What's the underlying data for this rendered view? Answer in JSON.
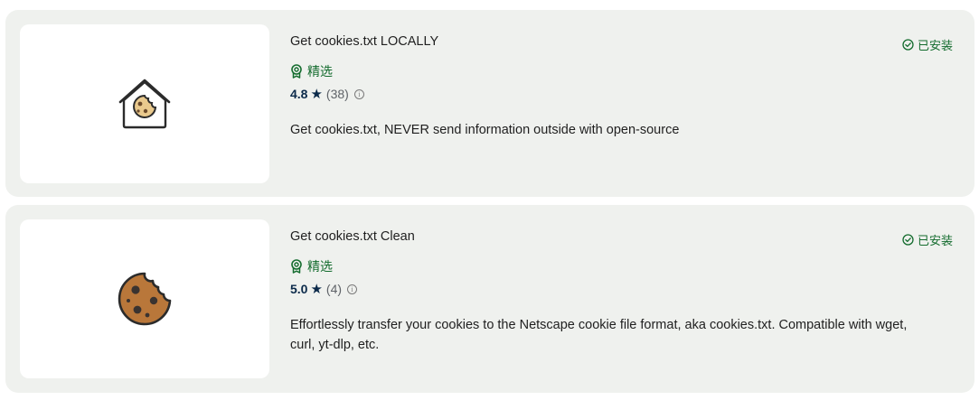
{
  "extensions": [
    {
      "title": "Get cookies.txt LOCALLY",
      "badge": "精选",
      "rating": "4.8",
      "rating_count": "(38)",
      "description": "Get cookies.txt, NEVER send information outside with open-source",
      "status": "已安装",
      "icon": "cookie-house-icon"
    },
    {
      "title": "Get cookies.txt Clean",
      "badge": "精选",
      "rating": "5.0",
      "rating_count": "(4)",
      "description": "Effortlessly transfer your cookies to the Netscape cookie file format, aka cookies.txt. Compatible with wget, curl, yt-dlp, etc.",
      "status": "已安装",
      "icon": "cookie-icon"
    }
  ],
  "colors": {
    "card_bg": "#eff1ee",
    "accent_green": "#146c2e",
    "rating_navy": "#0b2a4a"
  }
}
